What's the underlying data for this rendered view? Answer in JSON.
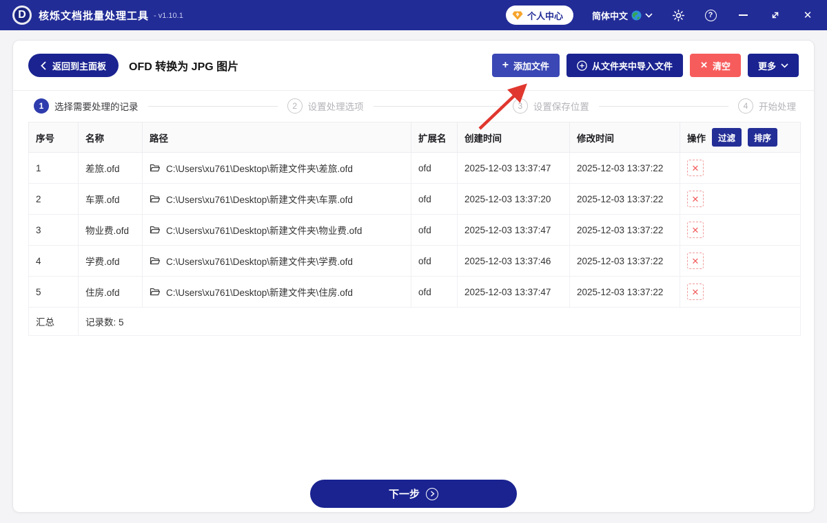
{
  "titlebar": {
    "logo_letter": "D",
    "app_title": "核烁文档批量处理工具",
    "version": "- v1.10.1",
    "user_center_label": "个人中心",
    "language_label": "简体中文",
    "icons": [
      "vip-diamond",
      "globe",
      "gear",
      "help",
      "minimize",
      "resize",
      "close"
    ]
  },
  "toolbar": {
    "back_label": "返回到主面板",
    "page_title": "OFD 转换为 JPG 图片",
    "add_files_label": "添加文件",
    "import_folder_label": "从文件夹中导入文件",
    "clear_label": "清空",
    "more_label": "更多"
  },
  "steps": [
    {
      "num": "1",
      "label": "选择需要处理的记录",
      "active": true
    },
    {
      "num": "2",
      "label": "设置处理选项",
      "active": false
    },
    {
      "num": "3",
      "label": "设置保存位置",
      "active": false
    },
    {
      "num": "4",
      "label": "开始处理",
      "active": false
    }
  ],
  "table": {
    "headers": {
      "index": "序号",
      "name": "名称",
      "path": "路径",
      "ext": "扩展名",
      "created": "创建时间",
      "modified": "修改时间",
      "ops": "操作"
    },
    "filter_label": "过滤",
    "sort_label": "排序",
    "rows": [
      {
        "index": "1",
        "name": "差旅.ofd",
        "path": "C:\\Users\\xu761\\Desktop\\新建文件夹\\差旅.ofd",
        "ext": "ofd",
        "created": "2025-12-03 13:37:47",
        "modified": "2025-12-03 13:37:22"
      },
      {
        "index": "2",
        "name": "车票.ofd",
        "path": "C:\\Users\\xu761\\Desktop\\新建文件夹\\车票.ofd",
        "ext": "ofd",
        "created": "2025-12-03 13:37:20",
        "modified": "2025-12-03 13:37:22"
      },
      {
        "index": "3",
        "name": "物业费.ofd",
        "path": "C:\\Users\\xu761\\Desktop\\新建文件夹\\物业费.ofd",
        "ext": "ofd",
        "created": "2025-12-03 13:37:47",
        "modified": "2025-12-03 13:37:22"
      },
      {
        "index": "4",
        "name": "学费.ofd",
        "path": "C:\\Users\\xu761\\Desktop\\新建文件夹\\学费.ofd",
        "ext": "ofd",
        "created": "2025-12-03 13:37:46",
        "modified": "2025-12-03 13:37:22"
      },
      {
        "index": "5",
        "name": "住房.ofd",
        "path": "C:\\Users\\xu761\\Desktop\\新建文件夹\\住房.ofd",
        "ext": "ofd",
        "created": "2025-12-03 13:37:47",
        "modified": "2025-12-03 13:37:22"
      }
    ],
    "summary_label": "汇总",
    "summary_value": "记录数: 5"
  },
  "footer": {
    "next_label": "下一步"
  },
  "colors": {
    "titlebar_bg": "#222c97",
    "primary_dark": "#1a2390",
    "primary_mid": "#3a47b4",
    "danger_red": "#f75c5c",
    "annotation_arrow": "#e0372e",
    "step_active": "#2f3cad"
  }
}
